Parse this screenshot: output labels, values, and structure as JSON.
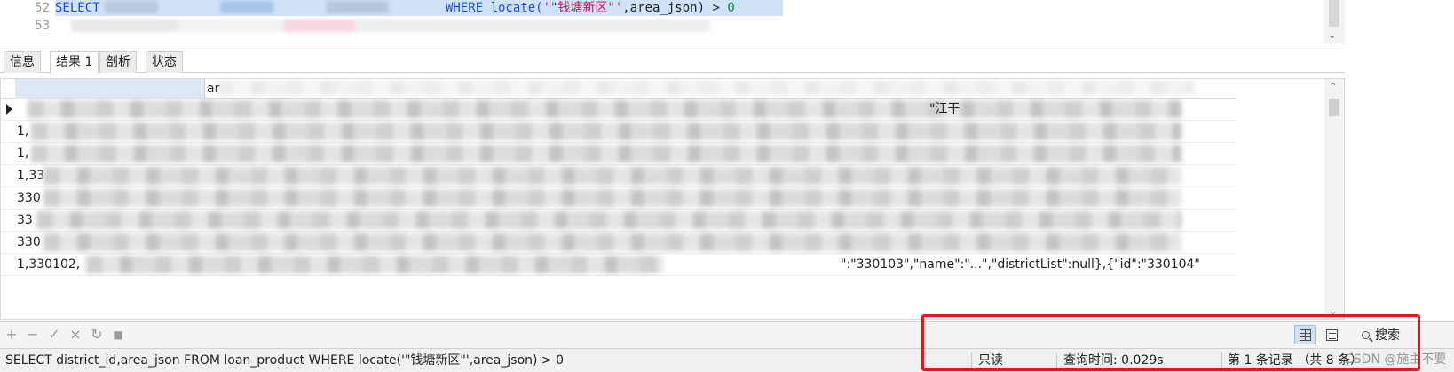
{
  "editor": {
    "lines": [
      {
        "number": "52",
        "keyword": "SELECT",
        "where_clause": "WHERE locate(",
        "string_literal": "'\"钱塘新区\"'",
        "after_string": ",area_json)  > ",
        "number_literal": "0"
      },
      {
        "number": "53"
      }
    ]
  },
  "tabs": [
    "信息",
    "结果 1",
    "剖析",
    "状态"
  ],
  "active_tab_index": 1,
  "grid": {
    "header_col2_partial": "ar",
    "row_prefixes": [
      "",
      "1,",
      "1,",
      "1,33",
      "330",
      "33",
      "330",
      "1,330102,"
    ],
    "row_right_fragments": [
      "\"江干",
      "",
      "",
      "",
      "",
      "",
      "",
      "\":\"330103\",\"name\":\"...\",\"districtList\":null},{\"id\":\"330104\""
    ]
  },
  "toolbar": {
    "buttons": [
      {
        "icon": "add-icon",
        "glyph": "+"
      },
      {
        "icon": "remove-icon",
        "glyph": "−"
      },
      {
        "icon": "apply-icon",
        "glyph": "✓"
      },
      {
        "icon": "discard-icon",
        "glyph": "×"
      },
      {
        "icon": "refresh-icon",
        "glyph": "↻"
      },
      {
        "icon": "stop-icon",
        "glyph": "■"
      }
    ],
    "search_label": "搜索"
  },
  "statusbar": {
    "query": "SELECT district_id,area_json FROM  loan_product  WHERE locate('\"钱塘新区\"',area_json)  > 0",
    "mode": "只读",
    "query_time": "查询时间: 0.029s",
    "record_info": "第 1 条记录 （共 8 条）"
  },
  "watermark": "CSDN @施主不要",
  "colors": {
    "keyword": "#1f4fd6",
    "string": "#c2185b",
    "number": "#0a8a3a",
    "selection": "#cfe2f7",
    "highlight_box": "#e01919"
  }
}
